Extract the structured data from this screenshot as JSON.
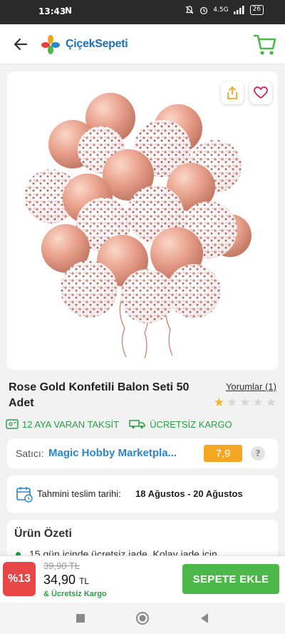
{
  "status_bar": {
    "time": "13:43",
    "carrier_glyph": "N",
    "network": "4.5G",
    "battery": "26"
  },
  "header": {
    "brand": "ÇiçekSepeti",
    "icons": {
      "back": "back-arrow-icon",
      "cart": "cart-icon"
    }
  },
  "gallery": {
    "share_icon": "share-icon",
    "favorite_icon": "heart-icon"
  },
  "product": {
    "title": "Rose Gold Konfetili Balon Seti 50 Adet",
    "reviews_link": "Yorumlar (1)",
    "rating_stars": 1,
    "rating_max": 5
  },
  "perks": {
    "installment": "12 AYA VARAN TAKSİT",
    "shipping": "ÜCRETSİZ KARGO"
  },
  "seller": {
    "label": "Satıcı:",
    "name": "Magic Hobby Marketpla...",
    "score": "7,9",
    "help": "?"
  },
  "delivery": {
    "label": "Tahmini teslim tarihi:",
    "value": "18 Ağustos - 20 Ağustos"
  },
  "summary": {
    "heading": "Ürün Özeti",
    "first_item": "15 gün içinde ücretsiz iade. Kolay iade için"
  },
  "purchase": {
    "discount": "%13",
    "old_price": "39,90 TL",
    "new_price": "34,90",
    "currency": "TL",
    "free_shipping": "& Ücretsiz Kargo",
    "add_to_cart": "SEPETE EKLE"
  },
  "colors": {
    "brand_blue": "#1d6fb8",
    "green": "#4db84a",
    "discount_red": "#e84646",
    "rating_orange": "#f5a623"
  }
}
